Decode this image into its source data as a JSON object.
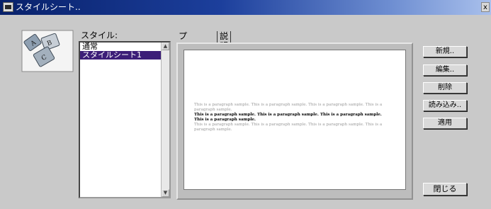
{
  "window": {
    "title": "スタイルシート..",
    "close_glyph": "x"
  },
  "styles": {
    "label": "スタイル:",
    "items": [
      {
        "label": "通常",
        "selected": false
      },
      {
        "label": "スタイルシート1",
        "selected": true
      }
    ]
  },
  "tabs": [
    {
      "label": "プレビュー",
      "active": true
    },
    {
      "label": "説明",
      "active": false
    }
  ],
  "preview": {
    "paragraphs": [
      {
        "text": "This is a paragraph sample. This is a paragraph sample. This is a paragraph sample. This is a paragraph sample.",
        "style": "gray"
      },
      {
        "text": "This is a paragraph sample. This is a paragraph sample. This is a paragraph sample. This is a paragraph sample.",
        "style": "bold"
      },
      {
        "text": "This is a paragraph sample. This is a paragraph sample. This is a paragraph sample. This is a paragraph sample.",
        "style": "gray"
      }
    ]
  },
  "buttons": {
    "new": "新規..",
    "edit": "編集..",
    "delete": "削除",
    "import": "読み込み..",
    "apply": "適用",
    "close": "閉じる"
  },
  "icons": {
    "logo": "stylesheet-dialog-logo",
    "app": "app-window-icon",
    "scroll_up": "scroll-up-arrow-icon",
    "scroll_down": "scroll-down-arrow-icon"
  },
  "colors": {
    "titlebar_start": "#08216b",
    "titlebar_end": "#a9c0ec",
    "selection": "#3c1e78",
    "dialog_bg": "#c9c9c9"
  }
}
